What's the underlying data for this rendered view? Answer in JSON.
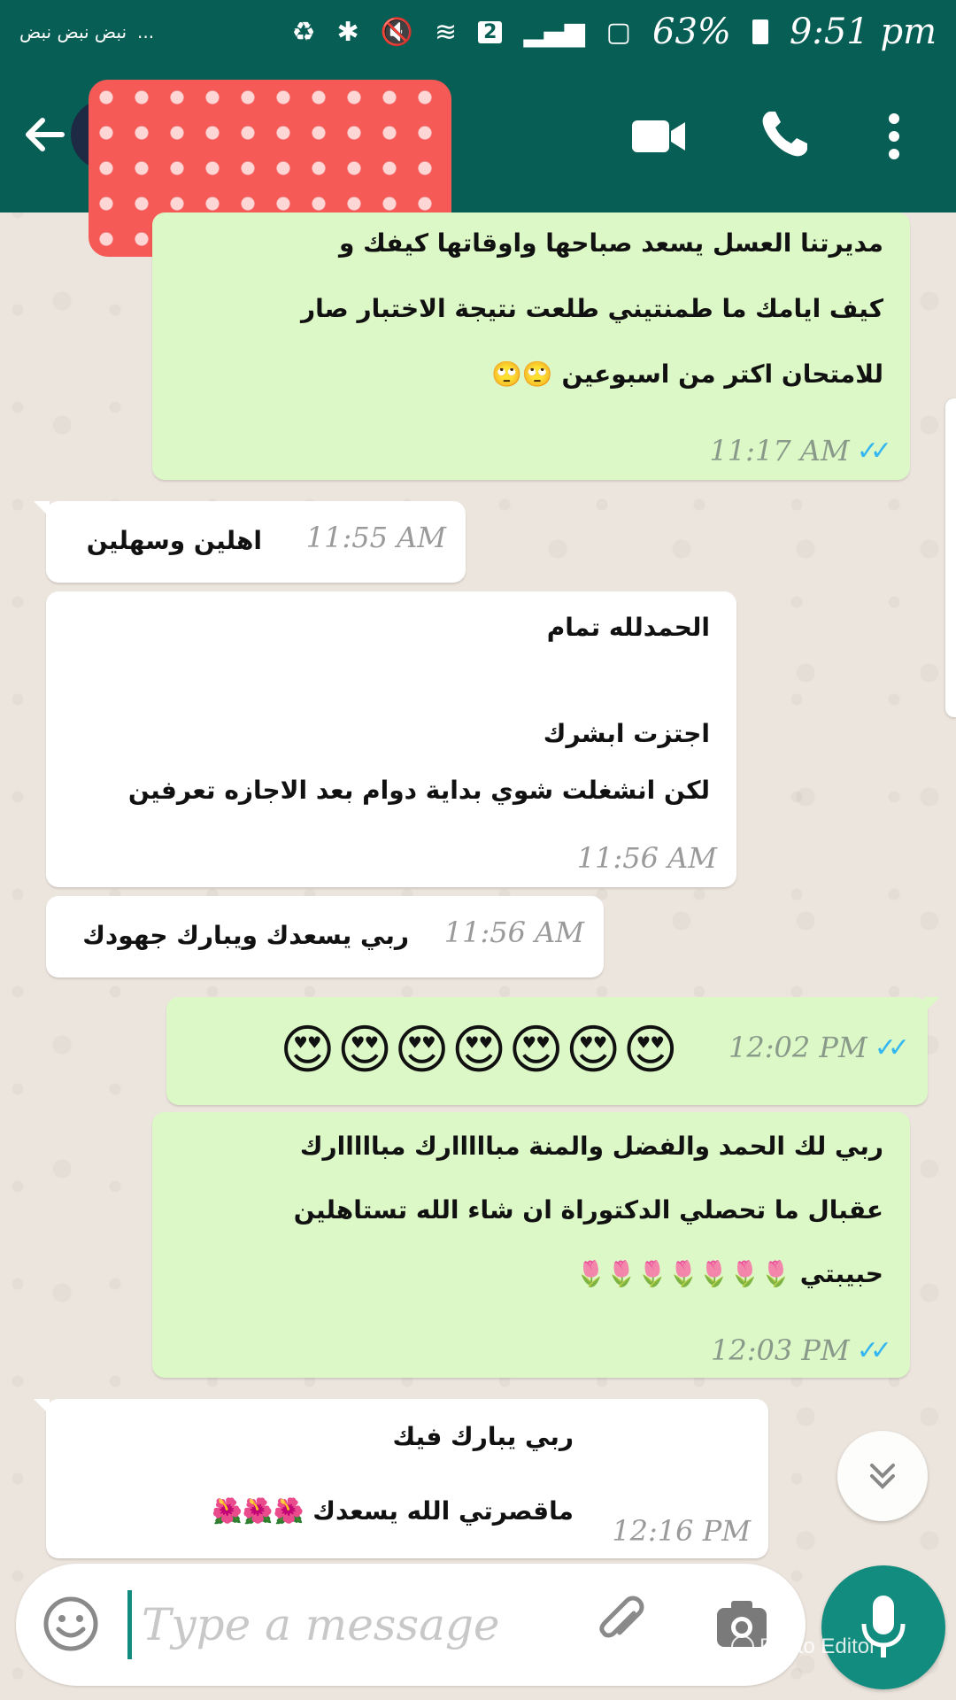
{
  "status_bar": {
    "carrier_text": "نبض نبض نبض",
    "dots": "...",
    "sim_label": "2",
    "battery": "63%",
    "time": "9:51 pm"
  },
  "header": {
    "contact_name": "",
    "icons": [
      "back-arrow-icon",
      "avatar",
      "video-call-icon",
      "phone-icon",
      "more-vert-icon"
    ]
  },
  "messages": [
    {
      "dir": "out",
      "lines": [
        "مديرتنا العسل يسعد صباحها واوقاتها كيفك و",
        "كيف ايامك ما طمنتيني طلعت نتيجة الاختبار صار",
        "للامتحان اكتر من اسبوعين 🙄🙄"
      ],
      "time": "11:17 AM",
      "ticks": "✓✓"
    },
    {
      "dir": "in",
      "lines": [
        "اهلين وسهلين"
      ],
      "time": "11:55 AM"
    },
    {
      "dir": "in",
      "lines": [
        "الحمدلله تمام",
        "",
        "اجتزت ابشرك",
        "لكن انشغلت شوي بداية دوام بعد الاجازه تعرفين"
      ],
      "time": "11:56 AM"
    },
    {
      "dir": "in",
      "lines": [
        "ربي يسعدك ويبارك جهودك"
      ],
      "time": "11:56 AM"
    },
    {
      "dir": "out",
      "emoji": "😍😍😍😍😍😍😍",
      "time": "12:02 PM",
      "ticks": "✓✓"
    },
    {
      "dir": "out",
      "lines": [
        "ربي لك الحمد والفضل والمنة مبااااارك مبااااارك",
        "عقبال ما تحصلي الدكتوراة ان شاء الله تستاهلين",
        "حبيبتي 🌷🌷🌷🌷🌷🌷🌷"
      ],
      "time": "12:03 PM",
      "ticks": "✓✓"
    },
    {
      "dir": "in",
      "lines": [
        "ربي يبارك فيك",
        "ماقصرتي الله يسعدك 🌺🌺🌺"
      ],
      "time": "12:16 PM"
    }
  ],
  "composer": {
    "placeholder": "Type a message",
    "icons": [
      "emoji-icon",
      "attach-icon",
      "camera-icon",
      "mic-icon"
    ]
  },
  "watermark": "Photo Editor",
  "colors": {
    "header": "#075e54",
    "outgoing_bubble": "#dcf8c6",
    "incoming_bubble": "#ffffff",
    "accent": "#128c7e",
    "ticks": "#34b7f1"
  }
}
